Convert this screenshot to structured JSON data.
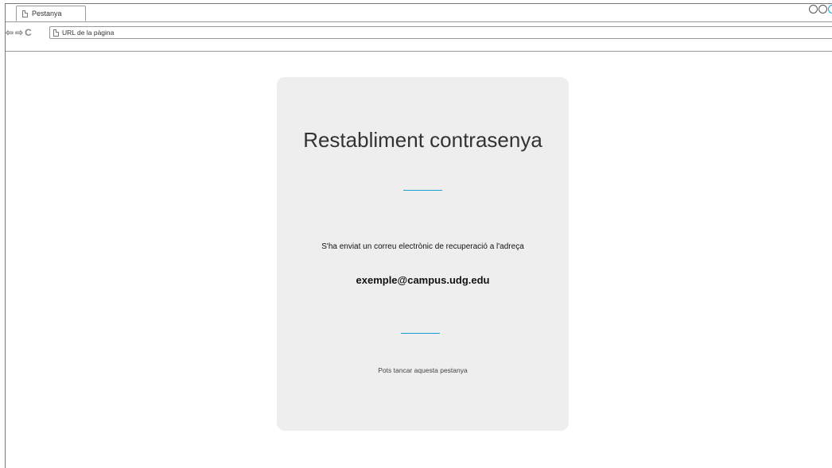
{
  "browser": {
    "tab_label": "Pestanya",
    "url_placeholder": "URL de la pàgina",
    "nav_icons": [
      "arrow-left-icon",
      "arrow-right-icon",
      "refresh-icon"
    ],
    "window_controls": [
      "circle-icon",
      "circle-icon",
      "circle-icon"
    ]
  },
  "card": {
    "title": "Restabliment contrasenya",
    "message": "S'ha enviat un correu electrònic de recuperació a l'adreça",
    "email": "exemple@campus.udg.edu",
    "closing": "Pots tancar aquesta pestanya"
  },
  "colors": {
    "accent": "#1aa0d6",
    "card_background": "#eeeeee",
    "text": "#333333"
  }
}
